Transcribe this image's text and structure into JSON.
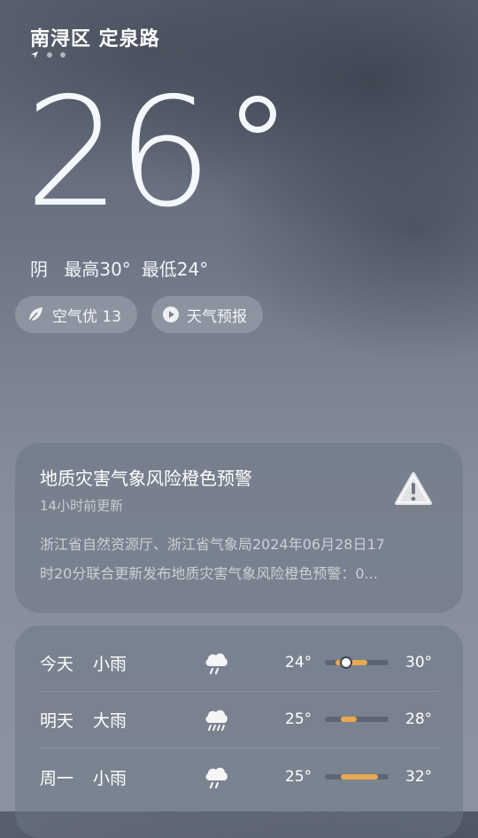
{
  "location": "南浔区 定泉路",
  "current": {
    "temperature": "26",
    "condition": "阴",
    "high_label": "最高30°",
    "low_label": "最低24°"
  },
  "pills": {
    "air_quality": "空气优 13",
    "forecast": "天气预报"
  },
  "alert": {
    "title": "地质灾害气象风险橙色预警",
    "updated": "14小时前更新",
    "body_line1": "浙江省自然资源厅、浙江省气象局2024年06月28日17",
    "body_line2": "时20分联合更新发布地质灾害气象风险橙色预警：0...",
    "icon": "warning-triangle-icon"
  },
  "forecast": [
    {
      "day": "今天",
      "desc": "小雨",
      "icon": "light-rain-icon",
      "low": "24°",
      "high": "30°",
      "range": [
        24,
        30
      ],
      "now": 26
    },
    {
      "day": "明天",
      "desc": "大雨",
      "icon": "heavy-rain-icon",
      "low": "25°",
      "high": "28°",
      "range": [
        25,
        28
      ]
    },
    {
      "day": "周一",
      "desc": "小雨",
      "icon": "light-rain-icon",
      "low": "25°",
      "high": "32°",
      "range": [
        25,
        32
      ]
    }
  ],
  "colors": {
    "temp_bar_fill": "#e8a951"
  }
}
